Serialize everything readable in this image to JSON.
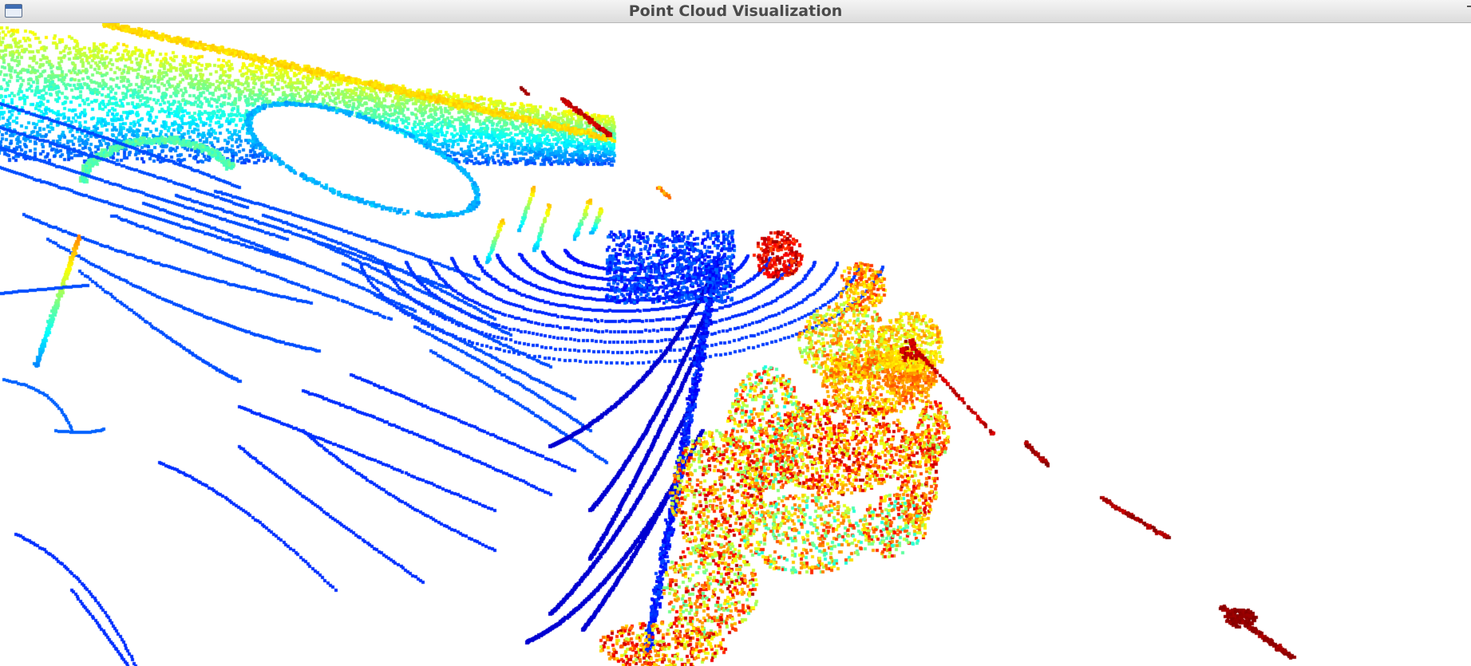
{
  "window": {
    "title": "Point Cloud Visualization"
  },
  "icons": {
    "window_menu": "window-menu-icon"
  },
  "viewport": {
    "background": "#ffffff",
    "colormap": "jet",
    "colormap_stops": [
      "#00008f",
      "#0000ff",
      "#0080ff",
      "#00ffff",
      "#80ff80",
      "#ffff00",
      "#ff8000",
      "#ff0000",
      "#800000"
    ]
  }
}
